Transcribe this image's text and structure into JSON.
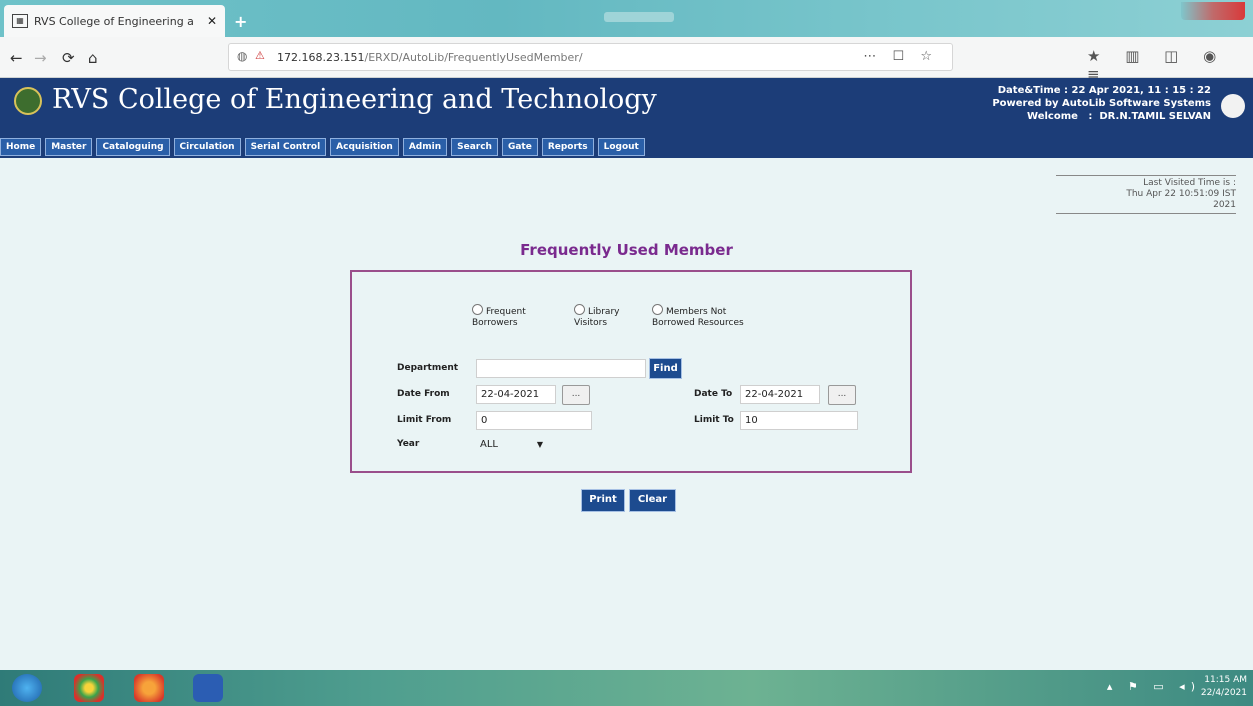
{
  "browser": {
    "tab_title": "RVS College of Engineering a",
    "tab_close": "✕",
    "new_tab": "+",
    "back": "←",
    "forward": "→",
    "reload": "⟳",
    "home": "⌂",
    "url_host": "172.168.23.151",
    "url_path": "/ERXD/AutoLib/FrequentlyUsedMember/",
    "url_actions": "⋯ ☐ ☆",
    "right_actions": "★ ▥ ◫ ◉ ≡"
  },
  "header": {
    "site_title": "RVS College of Engineering and Technology",
    "datetime_label": "Date&Time :",
    "datetime_value": "22 Apr 2021, 11 : 15 : 22",
    "powered_by": "Powered by AutoLib Software Systems",
    "welcome_label": "Welcome",
    "welcome_sep": ":",
    "user_name": "DR.N.TAMIL SELVAN"
  },
  "menu": [
    "Home",
    "Master",
    "Cataloguing",
    "Circulation",
    "Serial Control",
    "Acquisition",
    "Admin",
    "Search",
    "Gate",
    "Reports",
    "Logout"
  ],
  "last_visit": {
    "label": "Last Visited Time is :",
    "value": "Thu Apr 22 10:51:09 IST",
    "year": "2021"
  },
  "page_title": "Frequently Used Member",
  "options": [
    {
      "line1": "Frequent",
      "line2": "Borrowers"
    },
    {
      "line1": "Library",
      "line2": "Visitors"
    },
    {
      "line1": "Members Not",
      "line2": "Borrowed Resources"
    }
  ],
  "form": {
    "department_label": "Department",
    "department_value": "",
    "find_label": "Find",
    "date_from_label": "Date From",
    "date_from_value": "22-04-2021",
    "date_to_label": "Date To",
    "date_to_value": "22-04-2021",
    "cal_button": "...",
    "limit_from_label": "Limit From",
    "limit_from_value": "0",
    "limit_to_label": "Limit To",
    "limit_to_value": "10",
    "year_label": "Year",
    "year_value": "ALL"
  },
  "actions": {
    "print": "Print",
    "clear": "Clear"
  },
  "taskbar": {
    "tray": "▴ ⚑ ▭ ◂)",
    "time": "11:15 AM",
    "date": "22/4/2021"
  },
  "colors": {
    "header_bg": "#1c3d78",
    "menu_button": "#2a5fa8",
    "title_purple": "#7a2a8e",
    "panel_border": "#9a4e8b",
    "action_button": "#1d4b8f"
  }
}
